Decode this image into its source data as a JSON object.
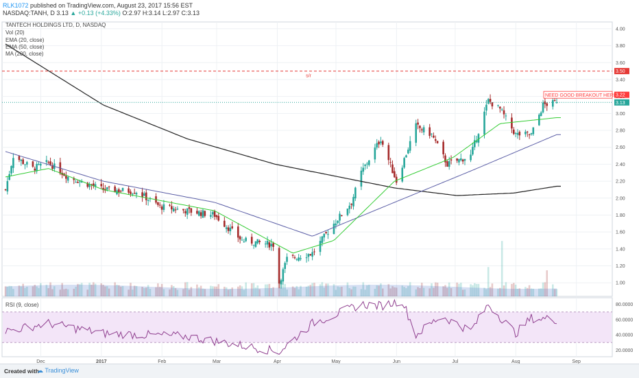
{
  "header": {
    "author": "RLK1072",
    "published_text": "published on TradingView.com, August 23, 2017 15:56 EST",
    "symbol": "NASDAQ:TANH, D",
    "price": "3.13",
    "change": "+0.13 (+4.33%)",
    "ohlc": "O:2.97 H:3.14 L:2.97 C:3.13"
  },
  "legend": {
    "title": "TANTECH HOLDINGS LTD, D, NASDAQ",
    "vol": "Vol (20)",
    "ema20": "EMA (20, close)",
    "ema50": "EMA (50, close)",
    "ma200": "MA (200, close)",
    "rsi": "RSI (9, close)"
  },
  "annotations": {
    "sr": "s/r",
    "breakout": "NEED GOOD BREAKOUT HERE"
  },
  "price_labels": {
    "resistance": "3.50",
    "breakout_level": "3.22",
    "last": "3.13"
  },
  "colors": {
    "up": "#26a69a",
    "down": "#a52a2a",
    "ema20": "#33cc33",
    "ema50": "#5b5ea6",
    "ma200": "#222222",
    "rsi": "#8e3d8e",
    "rsi_band": "#f3e5f8",
    "resistance": "#e53935",
    "breakout": "#ff3b3b",
    "last_price": "#26a69a"
  },
  "footer": {
    "created_with": "Created with",
    "logo": "TradingView"
  },
  "chart_data": {
    "type": "candlestick",
    "title": "TANTECH HOLDINGS LTD, D, NASDAQ",
    "y_axis": {
      "ticks": [
        4.0,
        3.8,
        3.6,
        3.4,
        3.2,
        3.0,
        2.8,
        2.6,
        2.4,
        2.2,
        2.0,
        1.8,
        1.6,
        1.4,
        1.2,
        1.0
      ],
      "range": [
        0.84,
        4.08
      ]
    },
    "x_axis": {
      "ticks": [
        "Dec",
        "2017",
        "Feb",
        "Mar",
        "Apr",
        "May",
        "Jun",
        "Jul",
        "Aug",
        "Sep"
      ]
    },
    "horizontal_lines": [
      {
        "label": "s/r",
        "value": 3.5,
        "style": "dashed"
      },
      {
        "label": "NEED GOOD BREAKOUT HERE",
        "value": 3.22
      }
    ],
    "last_close": 3.13,
    "price_keypoints": [
      {
        "date": "Nov 14",
        "close": 2.1
      },
      {
        "date": "Nov 18",
        "close": 2.5
      },
      {
        "date": "Nov 28",
        "close": 2.35
      },
      {
        "date": "Dec 06",
        "close": 2.42
      },
      {
        "date": "Dec 16",
        "close": 2.25
      },
      {
        "date": "Jan 03",
        "close": 2.1
      },
      {
        "date": "Jan 20",
        "close": 2.08
      },
      {
        "date": "Feb 01",
        "close": 1.9
      },
      {
        "date": "Feb 15",
        "close": 1.85
      },
      {
        "date": "Mar 01",
        "close": 1.8
      },
      {
        "date": "Mar 15",
        "close": 1.5
      },
      {
        "date": "Mar 31",
        "close": 1.45
      },
      {
        "date": "Apr 03",
        "close": 1.0
      },
      {
        "date": "Apr 07",
        "close": 1.28
      },
      {
        "date": "Apr 20",
        "close": 1.35
      },
      {
        "date": "May 01",
        "close": 1.7
      },
      {
        "date": "May 10",
        "close": 1.95
      },
      {
        "date": "May 15",
        "close": 2.3
      },
      {
        "date": "May 25",
        "close": 2.7
      },
      {
        "date": "Jun 02",
        "close": 2.2
      },
      {
        "date": "Jun 12",
        "close": 2.85
      },
      {
        "date": "Jun 20",
        "close": 2.75
      },
      {
        "date": "Jun 28",
        "close": 2.4
      },
      {
        "date": "Jul 10",
        "close": 2.5
      },
      {
        "date": "Jul 19",
        "close": 3.15
      },
      {
        "date": "Jul 25",
        "close": 3.05
      },
      {
        "date": "Aug 02",
        "close": 2.75
      },
      {
        "date": "Aug 10",
        "close": 2.75
      },
      {
        "date": "Aug 16",
        "close": 3.1
      },
      {
        "date": "Aug 23",
        "close": 3.13
      }
    ],
    "ma200_keypoints": [
      {
        "date": "Nov 14",
        "value": 3.82
      },
      {
        "date": "Jan 03",
        "value": 3.1
      },
      {
        "date": "Feb 15",
        "value": 2.7
      },
      {
        "date": "Apr 01",
        "value": 2.4
      },
      {
        "date": "Jun 01",
        "value": 2.12
      },
      {
        "date": "Jul 03",
        "value": 2.03
      },
      {
        "date": "Aug 01",
        "value": 2.06
      },
      {
        "date": "Aug 23",
        "value": 2.14
      }
    ],
    "ema50_keypoints": [
      {
        "date": "Nov 14",
        "value": 2.55
      },
      {
        "date": "Jan 03",
        "value": 2.2
      },
      {
        "date": "Mar 01",
        "value": 1.95
      },
      {
        "date": "Apr 20",
        "value": 1.55
      },
      {
        "date": "Jun 01",
        "value": 1.95
      },
      {
        "date": "Jul 10",
        "value": 2.32
      },
      {
        "date": "Aug 23",
        "value": 2.75
      }
    ],
    "ema20_keypoints": [
      {
        "date": "Nov 14",
        "value": 2.25
      },
      {
        "date": "Dec 06",
        "value": 2.35
      },
      {
        "date": "Jan 03",
        "value": 2.1
      },
      {
        "date": "Mar 01",
        "value": 1.85
      },
      {
        "date": "Apr 10",
        "value": 1.35
      },
      {
        "date": "May 01",
        "value": 1.5
      },
      {
        "date": "Jun 01",
        "value": 2.2
      },
      {
        "date": "Jul 01",
        "value": 2.48
      },
      {
        "date": "Jul 25",
        "value": 2.88
      },
      {
        "date": "Aug 23",
        "value": 2.95
      }
    ],
    "rsi": {
      "ticks": [
        80,
        60,
        40,
        20
      ],
      "band": [
        30,
        70
      ],
      "keypoints": [
        {
          "date": "Nov 14",
          "value": 45
        },
        {
          "date": "Dec 06",
          "value": 55
        },
        {
          "date": "Jan 03",
          "value": 42
        },
        {
          "date": "Feb 15",
          "value": 38
        },
        {
          "date": "Apr 03",
          "value": 18
        },
        {
          "date": "Apr 20",
          "value": 55
        },
        {
          "date": "May 15",
          "value": 80
        },
        {
          "date": "May 25",
          "value": 78
        },
        {
          "date": "Jun 05",
          "value": 85
        },
        {
          "date": "Jun 12",
          "value": 40
        },
        {
          "date": "Jun 25",
          "value": 65
        },
        {
          "date": "Jul 10",
          "value": 45
        },
        {
          "date": "Jul 19",
          "value": 80
        },
        {
          "date": "Aug 02",
          "value": 42
        },
        {
          "date": "Aug 10",
          "value": 62
        },
        {
          "date": "Aug 23",
          "value": 60
        }
      ]
    },
    "volume_spikes": [
      {
        "date": "Apr 03",
        "relative": 0.35
      },
      {
        "date": "Jul 19",
        "relative": 0.45
      },
      {
        "date": "Jul 26",
        "relative": 0.85
      },
      {
        "date": "Aug 18",
        "relative": 0.4
      }
    ]
  }
}
